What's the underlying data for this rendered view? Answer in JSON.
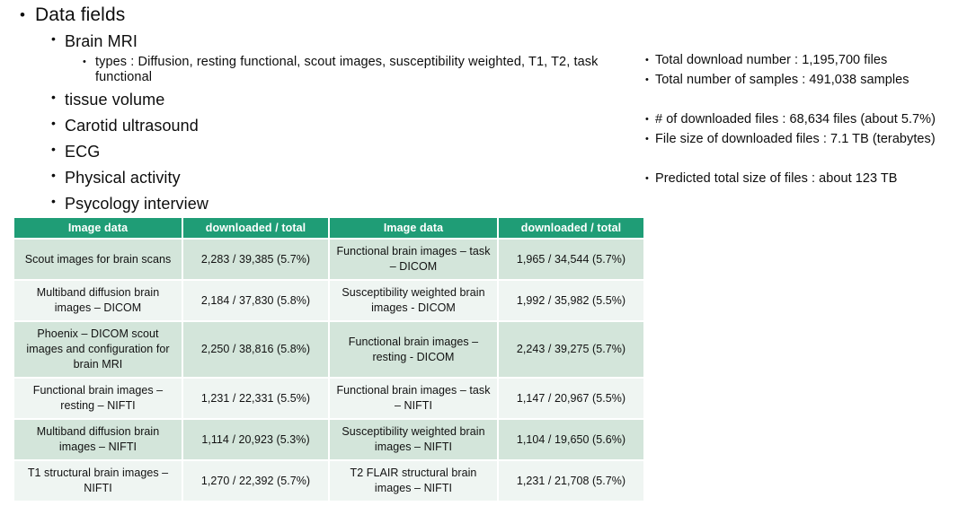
{
  "outline": {
    "bullet_glyph": "•",
    "items": [
      {
        "level": 1,
        "text": "Data fields"
      },
      {
        "level": 2,
        "text": "Brain MRI"
      },
      {
        "level": 3,
        "text": "types : Diffusion, resting functional, scout images, susceptibility weighted, T1, T2, task functional"
      },
      {
        "level": 2,
        "text": "tissue volume"
      },
      {
        "level": 2,
        "text": "Carotid ultrasound"
      },
      {
        "level": 2,
        "text": "ECG"
      },
      {
        "level": 2,
        "text": "Physical activity"
      },
      {
        "level": 2,
        "text": "Psycology interview"
      }
    ]
  },
  "stats": {
    "bullet_glyph": "•",
    "lines": [
      {
        "text": "Total download number : 1,195,700 files",
        "gap_after": false
      },
      {
        "text": "Total number of samples : 491,038 samples",
        "gap_after": true
      },
      {
        "text": "# of downloaded files : 68,634 files (about 5.7%)",
        "gap_after": false
      },
      {
        "text": "File size of downloaded files : 7.1 TB (terabytes)",
        "gap_after": true
      },
      {
        "text": "Predicted total size of files : about 123 TB",
        "gap_after": false
      }
    ]
  },
  "table": {
    "headers": [
      "Image data",
      "downloaded / total",
      "Image data",
      "downloaded / total"
    ],
    "rows": [
      {
        "shade": "dark",
        "cells": [
          "Scout images for brain scans",
          "2,283 / 39,385 (5.7%)",
          "Functional brain images – task – DICOM",
          "1,965 / 34,544 (5.7%)"
        ]
      },
      {
        "shade": "light",
        "cells": [
          "Multiband diffusion brain images – DICOM",
          "2,184 / 37,830 (5.8%)",
          "Susceptibility weighted brain images - DICOM",
          "1,992 / 35,982 (5.5%)"
        ]
      },
      {
        "shade": "dark",
        "cells": [
          "Phoenix – DICOM scout images and configuration for brain MRI",
          "2,250 / 38,816 (5.8%)",
          "Functional brain images – resting - DICOM",
          "2,243 / 39,275 (5.7%)"
        ]
      },
      {
        "shade": "light",
        "cells": [
          "Functional brain images – resting – NIFTI",
          "1,231 / 22,331 (5.5%)",
          "Functional brain images – task – NIFTI",
          "1,147 / 20,967 (5.5%)"
        ]
      },
      {
        "shade": "dark",
        "cells": [
          "Multiband diffusion brain images – NIFTI",
          "1,114 / 20,923 (5.3%)",
          "Susceptibility weighted brain images – NIFTI",
          "1,104 / 19,650 (5.6%)"
        ]
      },
      {
        "shade": "light",
        "cells": [
          "T1 structural brain images – NIFTI",
          "1,270 / 22,392 (5.7%)",
          "T2 FLAIR structural brain images – NIFTI",
          "1,231 / 21,708 (5.7%)"
        ]
      }
    ]
  },
  "colors": {
    "header_green": "#1F9D76",
    "row_dark": "#D3E5DA",
    "row_light": "#EFF5F2",
    "text": "#0d0d0d",
    "background": "#ffffff"
  }
}
